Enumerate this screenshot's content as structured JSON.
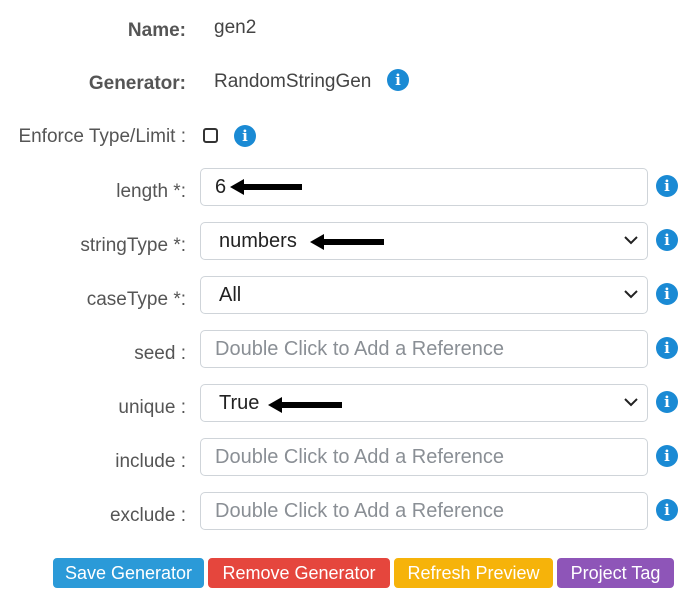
{
  "form": {
    "name": {
      "label": "Name:",
      "value": "gen2"
    },
    "generator": {
      "label": "Generator:",
      "value": "RandomStringGen"
    },
    "enforce": {
      "label": "Enforce Type/Limit :",
      "checked": false
    },
    "length": {
      "label": "length *:",
      "value": "6"
    },
    "stringType": {
      "label": "stringType *:",
      "value": "numbers"
    },
    "caseType": {
      "label": "caseType *:",
      "value": "All"
    },
    "seed": {
      "label": "seed :",
      "placeholder": "Double Click to Add a Reference"
    },
    "unique": {
      "label": "unique :",
      "value": "True"
    },
    "include": {
      "label": "include :",
      "placeholder": "Double Click to Add a Reference"
    },
    "exclude": {
      "label": "exclude :",
      "placeholder": "Double Click to Add a Reference"
    }
  },
  "buttons": {
    "save": {
      "label": "Save Generator",
      "color": "#2b9ad8"
    },
    "remove": {
      "label": "Remove Generator",
      "color": "#e5463d"
    },
    "refresh": {
      "label": "Refresh Preview",
      "color": "#f6b30a"
    },
    "tag": {
      "label": "Project Tag",
      "color": "#8e55b8"
    }
  },
  "icons": {
    "info": "info-icon",
    "arrow": "left-arrow-annotation",
    "chevron": "chevron-down-icon"
  },
  "info_glyph": "i"
}
